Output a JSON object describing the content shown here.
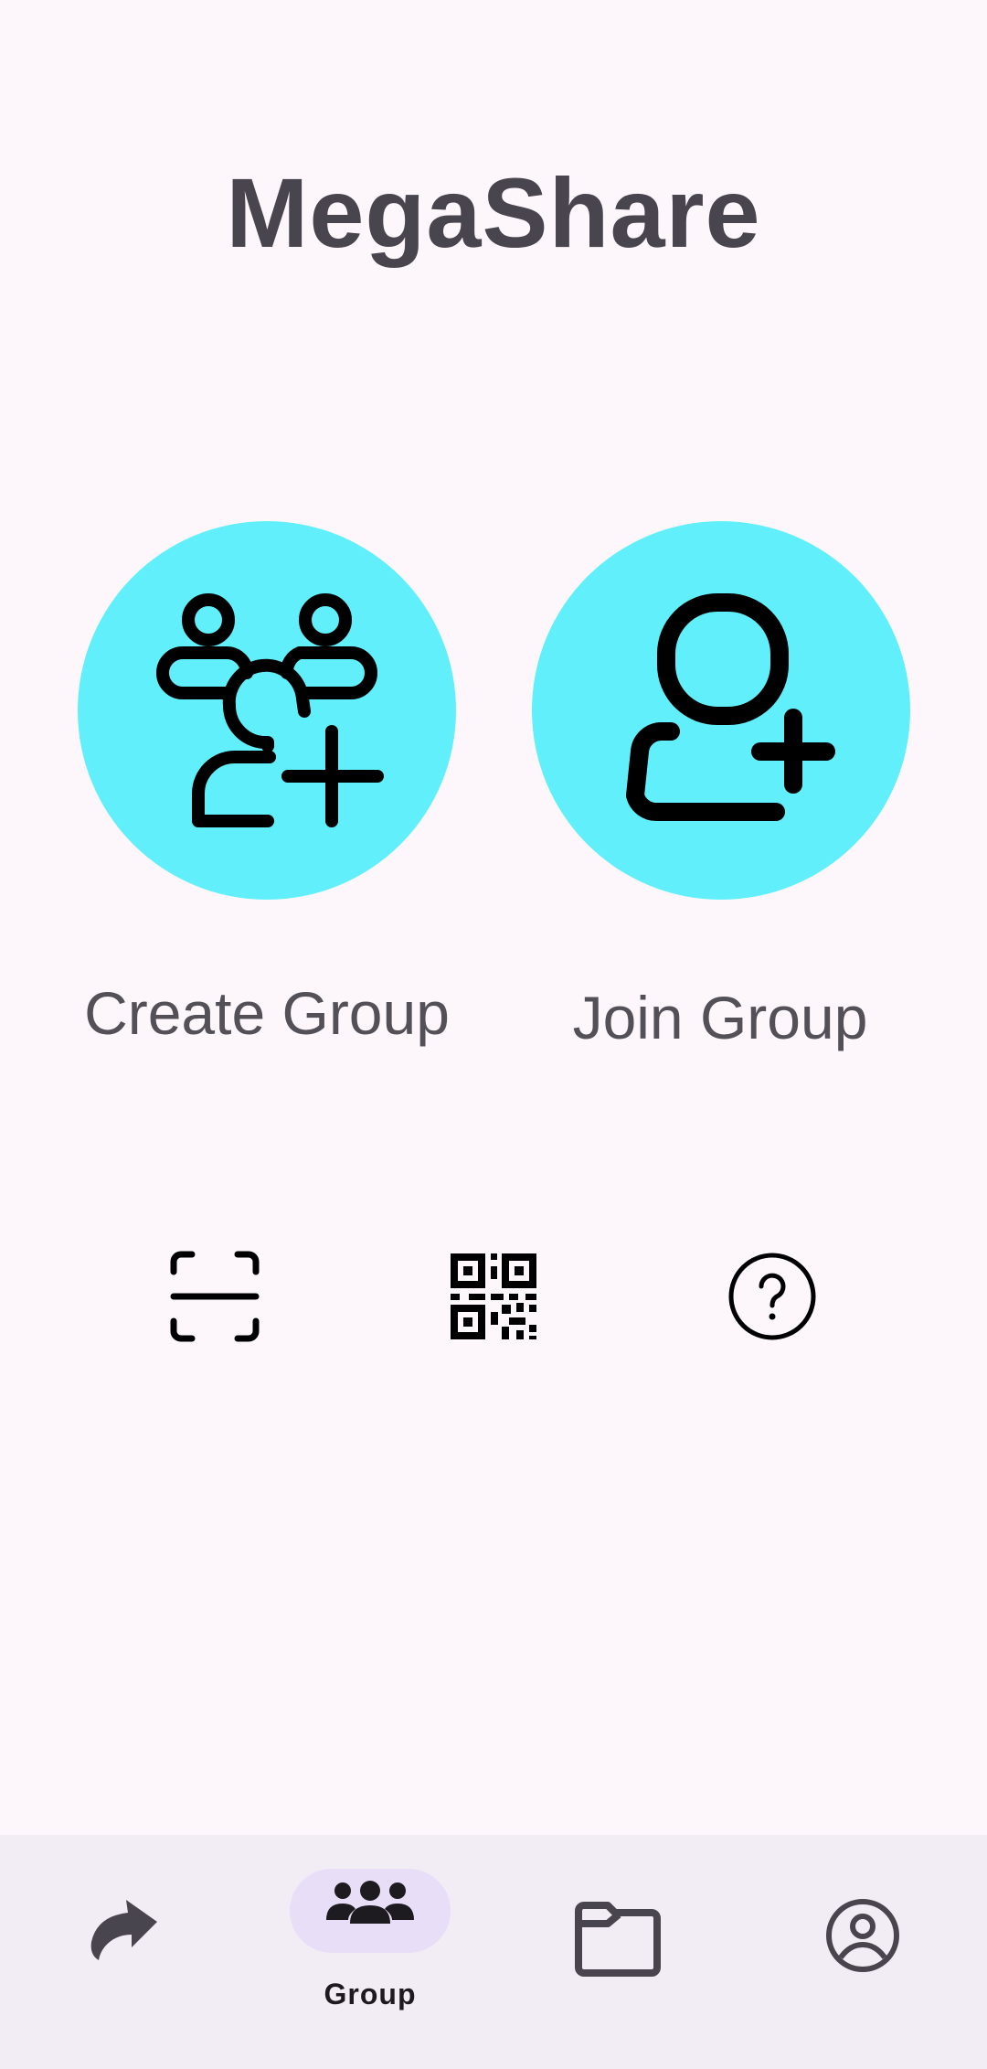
{
  "app": {
    "title": "MegaShare"
  },
  "actions": {
    "create": {
      "label": "Create Group",
      "icon": "group-add-icon"
    },
    "join": {
      "label": "Join Group",
      "icon": "person-add-icon"
    }
  },
  "tools": [
    {
      "icon": "scan-icon"
    },
    {
      "icon": "qr-code-icon"
    },
    {
      "icon": "help-icon"
    }
  ],
  "nav": {
    "items": [
      {
        "icon": "share-icon",
        "label": ""
      },
      {
        "icon": "group-icon",
        "label": "Group",
        "selected": true
      },
      {
        "icon": "folder-icon",
        "label": ""
      },
      {
        "icon": "account-icon",
        "label": ""
      }
    ]
  },
  "colors": {
    "background": "#fdf7fc",
    "accent_circle": "#61f0fb",
    "nav_background": "#f2ecf4",
    "nav_selected_pill": "#e8def8",
    "title": "#49454f"
  }
}
